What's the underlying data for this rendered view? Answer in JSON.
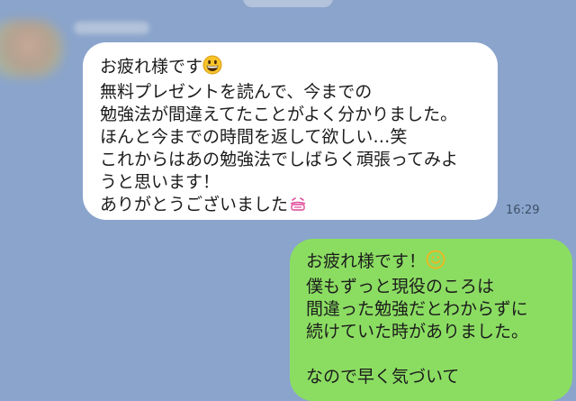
{
  "chat": {
    "incoming": {
      "lines": [
        "お疲れ様です",
        "無料プレゼントを読んで、今までの",
        "勉強法が間違えてたことがよく分かりました。",
        "ほんと今までの時間を返して欲しい…笑",
        "これからはあの勉強法でしばらく頑張ってみよ",
        "うと思います！",
        "ありがとうございました"
      ],
      "time": "16:29"
    },
    "outgoing": {
      "lines": [
        "お疲れ様です！",
        "僕もずっと現役のころは",
        "間違った勉強だとわからずに",
        "続けていた時がありました。",
        "",
        "なので早く気づいて"
      ]
    }
  },
  "icons": {
    "grin": "grinning-face-emoji",
    "smile": "smiling-face-emoji",
    "bow": "bowing-emoji"
  },
  "colors": {
    "background": "#8aa4cc",
    "incoming_bubble": "#ffffff",
    "outgoing_bubble": "#8bdd62",
    "text": "#1c1c1c"
  }
}
